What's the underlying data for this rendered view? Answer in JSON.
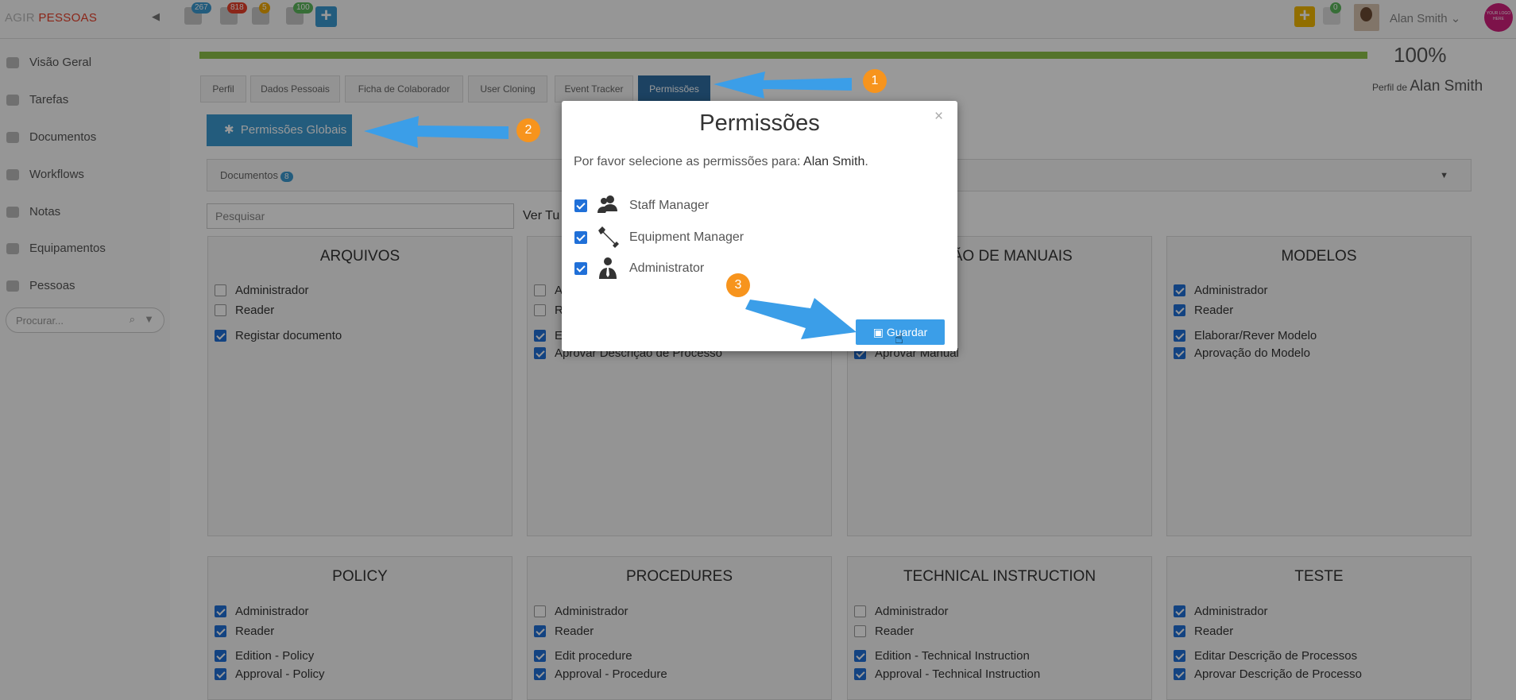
{
  "app": {
    "brand_a": "AGIR",
    "brand_b": "PESSOAS"
  },
  "topbar": {
    "badges": [
      {
        "name": "calendar",
        "count": "267"
      },
      {
        "name": "alerts",
        "count": "818"
      },
      {
        "name": "tasks",
        "count": "5"
      },
      {
        "name": "notifications",
        "count": "100"
      }
    ],
    "chat_count": "0",
    "user_name": "Alan Smith",
    "logo_text": "YOUR LOGO HERE"
  },
  "sidebar": {
    "items": [
      "Visão Geral",
      "Tarefas",
      "Documentos",
      "Workflows",
      "Notas",
      "Equipamentos",
      "Pessoas"
    ],
    "search_placeholder": "Procurar..."
  },
  "profile": {
    "progress_pct": "100%",
    "progress_value": 1.0,
    "perfil_de": "Perfil de",
    "name": "Alan Smith",
    "tabs": [
      "Perfil",
      "Dados Pessoais",
      "Ficha de Colaborador",
      "User Cloning",
      "Event Tracker",
      "Permissões"
    ],
    "active_tab": "Permissões"
  },
  "globais_label": "Permissões Globais",
  "docbar": {
    "label": "Documentos",
    "count": "8"
  },
  "search_placeholder": "Pesquisar",
  "ver_todos": "Ver Tu",
  "cards": [
    {
      "title": "ARQUIVOS",
      "items": [
        {
          "label": "Administrador",
          "checked": false
        },
        {
          "label": "Reader",
          "checked": false
        },
        {
          "label": "Registar documento",
          "checked": true
        }
      ]
    },
    {
      "title": "",
      "items": [
        {
          "label": "A",
          "checked": false
        },
        {
          "label": "R",
          "checked": false
        },
        {
          "label": "E",
          "checked": true
        },
        {
          "label": "Aprovar Descrição de Processo",
          "checked": true
        }
      ]
    },
    {
      "title": "ÇÃO DE MANUAIS",
      "items": [
        {
          "label": "Aprovar Manual",
          "checked": true
        }
      ]
    },
    {
      "title": "MODELOS",
      "items": [
        {
          "label": "Administrador",
          "checked": true
        },
        {
          "label": "Reader",
          "checked": true
        },
        {
          "label": "Elaborar/Rever Modelo",
          "checked": true
        },
        {
          "label": "Aprovação do Modelo",
          "checked": true
        }
      ]
    },
    {
      "title": "POLICY",
      "items": [
        {
          "label": "Administrador",
          "checked": true
        },
        {
          "label": "Reader",
          "checked": true
        },
        {
          "label": "Edition - Policy",
          "checked": true
        },
        {
          "label": "Approval - Policy",
          "checked": true
        }
      ]
    },
    {
      "title": "PROCEDURES",
      "items": [
        {
          "label": "Administrador",
          "checked": false
        },
        {
          "label": "Reader",
          "checked": true
        },
        {
          "label": "Edit procedure",
          "checked": true
        },
        {
          "label": "Approval - Procedure",
          "checked": true
        }
      ]
    },
    {
      "title": "TECHNICAL INSTRUCTION",
      "items": [
        {
          "label": "Administrador",
          "checked": false
        },
        {
          "label": "Reader",
          "checked": false
        },
        {
          "label": "Edition - Technical Instruction",
          "checked": true
        },
        {
          "label": "Approval - Technical Instruction",
          "checked": true
        }
      ]
    },
    {
      "title": "TESTE",
      "items": [
        {
          "label": "Administrador",
          "checked": true
        },
        {
          "label": "Reader",
          "checked": true
        },
        {
          "label": "Editar Descrição de Processos",
          "checked": true
        },
        {
          "label": "Aprovar Descrição de Processo",
          "checked": true
        }
      ]
    }
  ],
  "modal": {
    "title": "Permissões",
    "close": "×",
    "intro": "Por favor selecione as permissões para:",
    "user": "Alan Smith",
    "period": ".",
    "permissions": [
      {
        "label": "Staff Manager",
        "icon": "staff-manager-icon",
        "checked": true
      },
      {
        "label": "Equipment Manager",
        "icon": "wrench-icon",
        "checked": true
      },
      {
        "label": "Administrator",
        "icon": "administrator-icon",
        "checked": true
      }
    ],
    "save_label": "Guardar"
  },
  "steps": [
    "1",
    "2",
    "3"
  ],
  "colors": {
    "accent": "#3b9ad1",
    "brand": "#e8402a",
    "progress": "#8dc24a",
    "step": "#f7941d",
    "arrow": "#3b9ee8"
  }
}
